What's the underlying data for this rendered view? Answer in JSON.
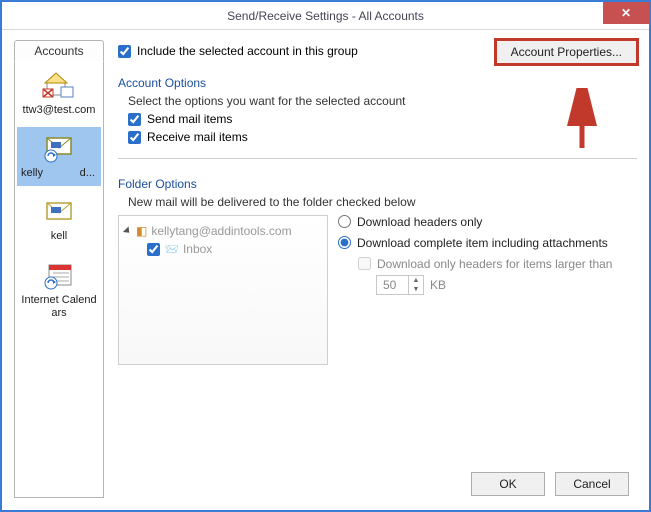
{
  "window": {
    "title": "Send/Receive Settings - All Accounts",
    "close_label": "✕"
  },
  "sidebar": {
    "tab_label": "Accounts",
    "items": [
      {
        "label": "ttw3@test.com",
        "icon": "house-mail-icon"
      },
      {
        "label": "kelly            d...",
        "icon": "envelope-sync-icon"
      },
      {
        "label": "kell",
        "icon": "envelope-icon"
      },
      {
        "label": "Internet Calendars",
        "icon": "calendar-sync-icon"
      }
    ]
  },
  "main": {
    "include_label": "Include the selected account in this group",
    "account_properties_label": "Account Properties...",
    "account_options_title": "Account Options",
    "account_options_subtitle": "Select the options you want for the selected account",
    "send_mail_label": "Send mail items",
    "receive_mail_label": "Receive mail items",
    "folder_options_title": "Folder Options",
    "folder_options_subtitle": "New mail will be delivered to the folder checked below",
    "tree": {
      "root": "kellytang@addintools.com",
      "child": "Inbox"
    },
    "download": {
      "headers_only": "Download headers only",
      "complete_item": "Download complete item including attachments",
      "only_headers_larger": "Download only headers for items larger than",
      "size_value": "50",
      "size_unit": "KB"
    }
  },
  "footer": {
    "ok_label": "OK",
    "cancel_label": "Cancel"
  }
}
